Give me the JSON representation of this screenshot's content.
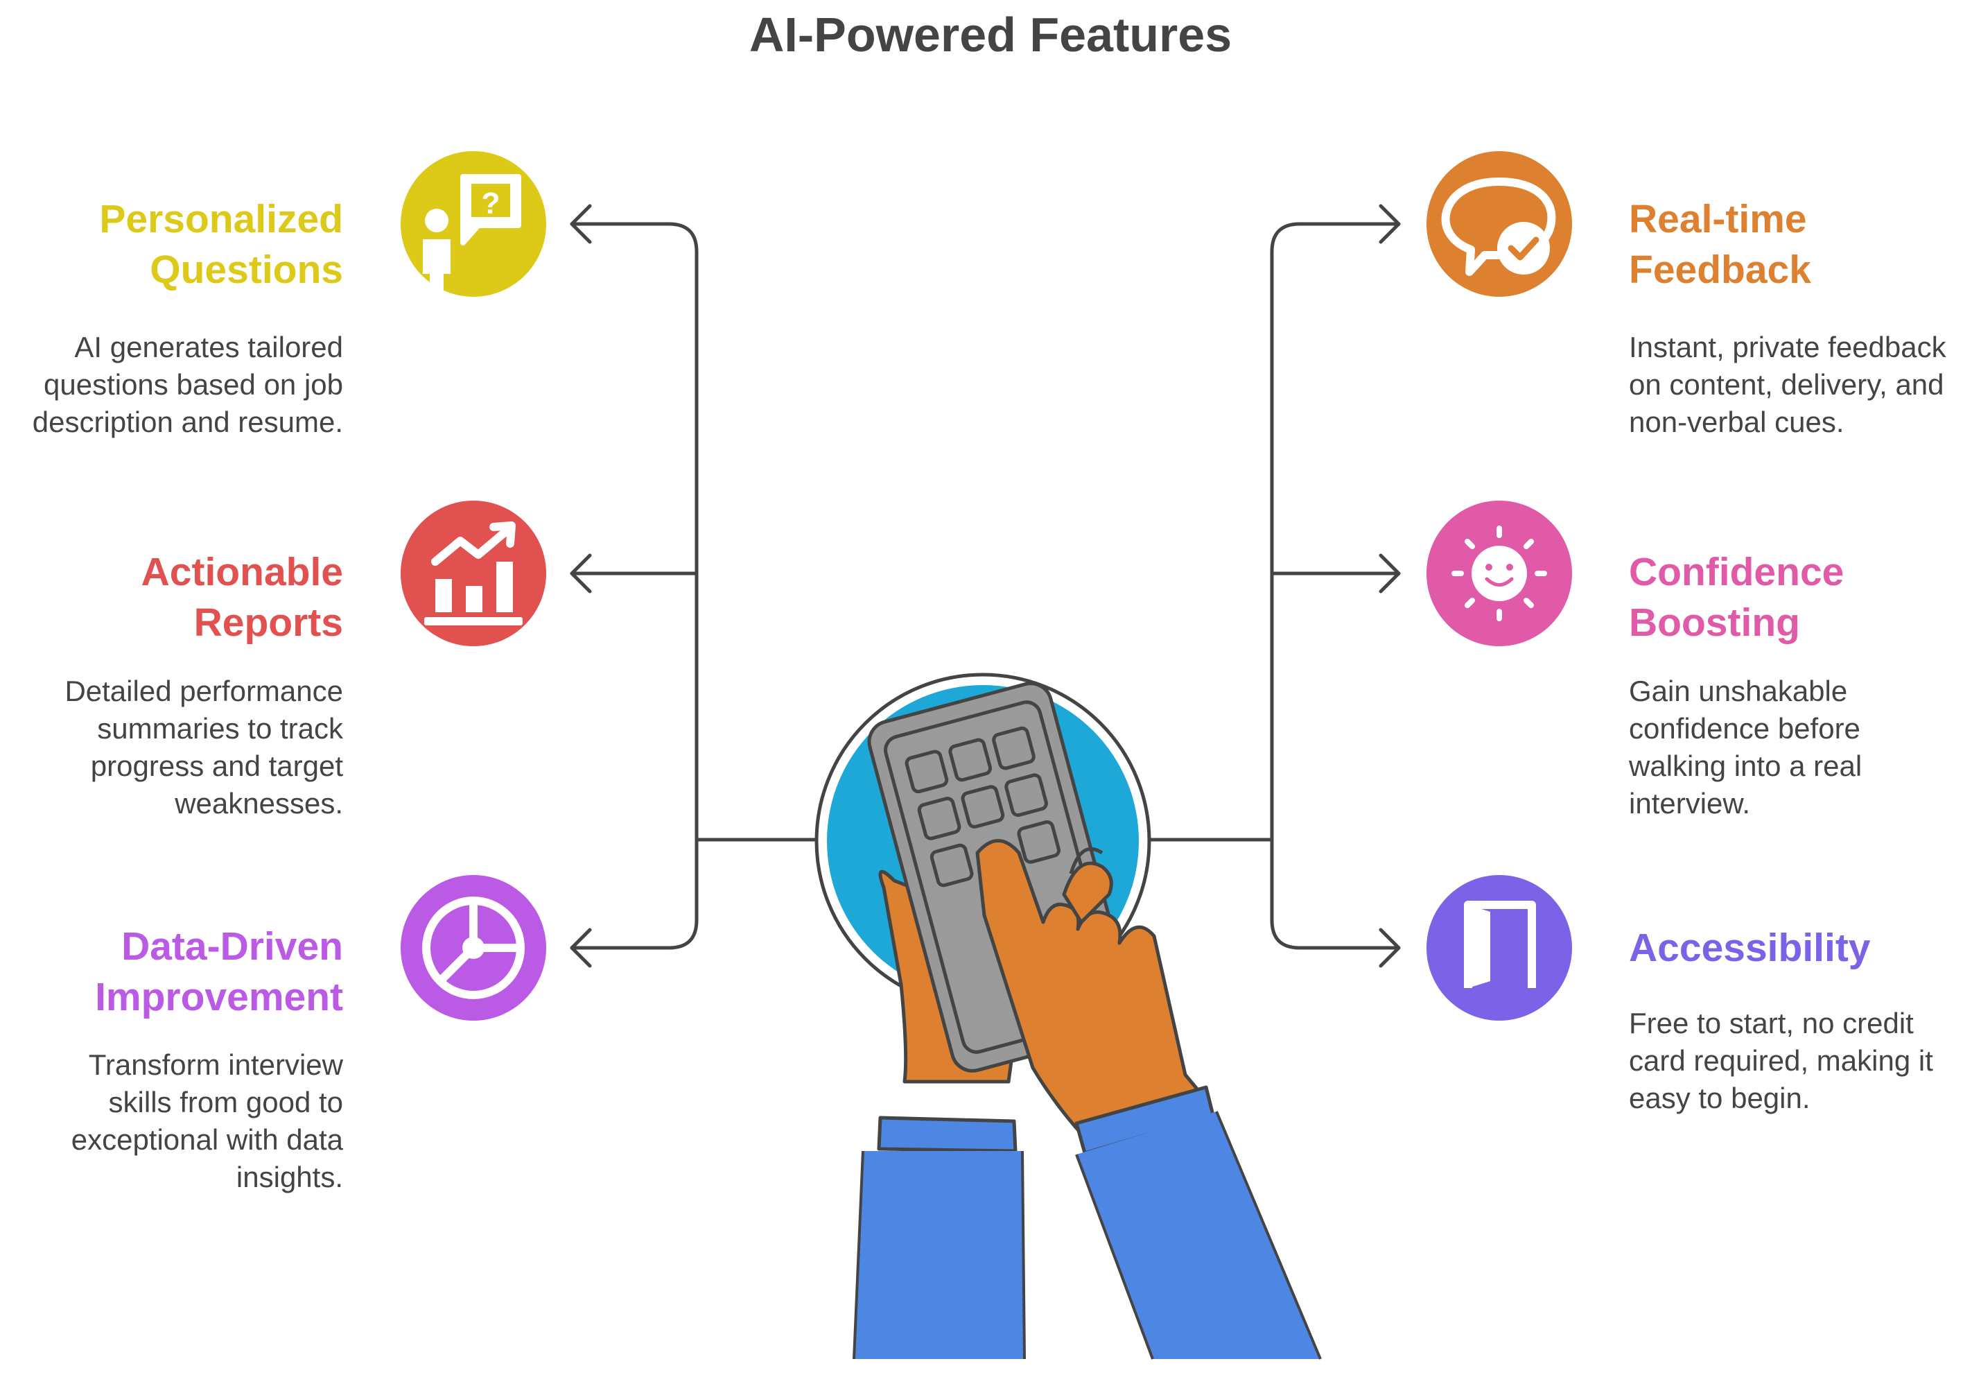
{
  "title": "AI-Powered Features",
  "colors": {
    "personalized": "#DDC917",
    "reports": "#E0514F",
    "data_driven": "#BA5AE5",
    "feedback": "#DD8130",
    "confidence": "#E05AA8",
    "accessibility": "#7B62E6",
    "connector": "#444444",
    "globe": "#1EA8D8",
    "skin": "#DD8130",
    "sleeve": "#4E86E4",
    "device": "#999999"
  },
  "features": {
    "personalized": {
      "title": [
        "Personalized",
        "Questions"
      ],
      "desc": [
        "AI generates tailored",
        "questions based on job",
        "description and resume."
      ],
      "icon": "question-speech-person-icon"
    },
    "reports": {
      "title": [
        "Actionable",
        "Reports"
      ],
      "desc": [
        "Detailed performance",
        "summaries to track",
        "progress and target",
        "weaknesses."
      ],
      "icon": "bar-chart-trend-icon"
    },
    "data_driven": {
      "title": [
        "Data-Driven",
        "Improvement"
      ],
      "desc": [
        "Transform interview",
        "skills from good to",
        "exceptional with data",
        "insights."
      ],
      "icon": "pie-chart-icon"
    },
    "feedback": {
      "title": [
        "Real-time",
        "Feedback"
      ],
      "desc": [
        "Instant, private feedback",
        "on content, delivery, and",
        "non-verbal cues."
      ],
      "icon": "speech-check-icon"
    },
    "confidence": {
      "title": [
        "Confidence",
        "Boosting"
      ],
      "desc": [
        "Gain unshakable",
        "confidence before",
        "walking into a real",
        "interview."
      ],
      "icon": "smiling-sun-icon"
    },
    "accessibility": {
      "title": [
        "Accessibility"
      ],
      "desc": [
        "Free to start, no credit",
        "card required, making it",
        "easy to begin."
      ],
      "icon": "open-door-icon"
    }
  }
}
